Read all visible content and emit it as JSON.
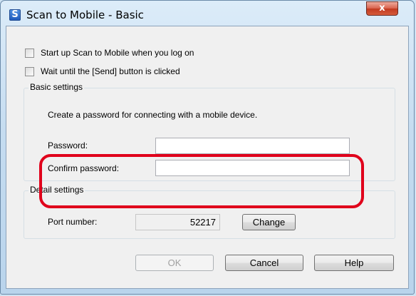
{
  "window": {
    "title": "Scan to Mobile - Basic",
    "app_icon_glyph": "S",
    "close_glyph": "x"
  },
  "options": {
    "startup": {
      "label": "Start up Scan to Mobile when you log on",
      "checked": false
    },
    "wait_send": {
      "label": "Wait until the [Send] button is clicked",
      "checked": false
    }
  },
  "basic_settings": {
    "title": "Basic settings",
    "description": "Create a password for connecting with a mobile device.",
    "password_label": "Password:",
    "password_value": "",
    "confirm_label": "Confirm password:",
    "confirm_value": ""
  },
  "detail_settings": {
    "title": "Detail settings",
    "port_label": "Port number:",
    "port_value": "52217",
    "change_label": "Change"
  },
  "buttons": {
    "ok": "OK",
    "cancel": "Cancel",
    "help": "Help"
  },
  "colors": {
    "highlight": "#e0001b",
    "client_bg": "#f0f0f0"
  }
}
